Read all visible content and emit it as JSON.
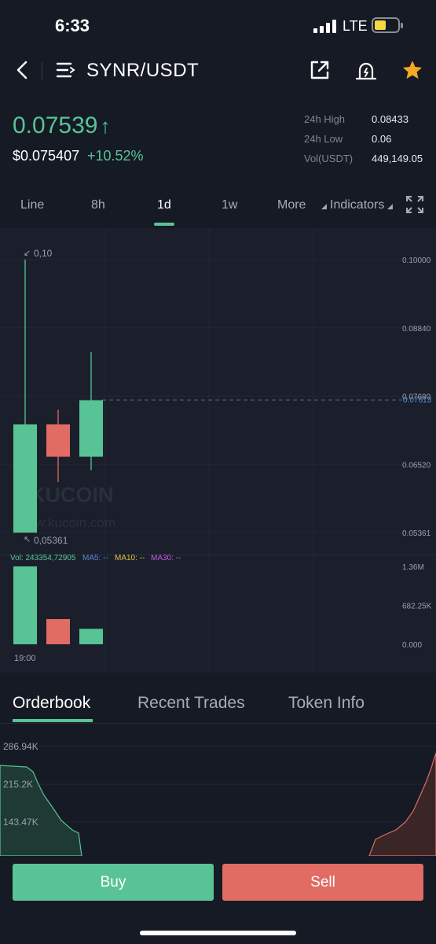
{
  "status": {
    "time": "6:33",
    "network": "LTE"
  },
  "header": {
    "pair": "SYNR/USDT"
  },
  "ticker": {
    "last_price": "0.07539",
    "arrow": "↑",
    "price_usd": "$0.075407",
    "change": "+10.52%",
    "high_label": "24h High",
    "high_value": "0.08433",
    "low_label": "24h Low",
    "low_value": "0.06",
    "vol_label": "Vol(USDT)",
    "vol_value": "449,149.05"
  },
  "timeframes": {
    "line": "Line",
    "h8": "8h",
    "d1": "1d",
    "w1": "1w",
    "more": "More",
    "indicators": "Indicators"
  },
  "colors": {
    "up": "#58c495",
    "down": "#e06c64",
    "bg": "#161a25",
    "chart_bg": "#1b1f2b"
  },
  "chart_data": {
    "type": "candlestick",
    "price_axis_labels": [
      "0.10000",
      "0.08840",
      "0.07680",
      "0.06520",
      "0.05361"
    ],
    "price_ylim": [
      0.05361,
      0.1
    ],
    "max_label": "0,10",
    "min_label": "0,05361",
    "current_price_label": "0.07613",
    "current_price": 0.07613,
    "watermark_brand": "KUCOIN",
    "watermark_url": "w.kucoin.com",
    "candles": [
      {
        "open": 0.072,
        "close": 0.0536,
        "high": 0.1,
        "low": 0.0536,
        "direction": "up"
      },
      {
        "open": 0.072,
        "close": 0.0665,
        "high": 0.0745,
        "low": 0.0622,
        "direction": "down"
      },
      {
        "open": 0.0665,
        "close": 0.0761,
        "high": 0.0843,
        "low": 0.0642,
        "direction": "up"
      }
    ],
    "volume_legend": {
      "vol": "Vol: 243354,72905",
      "ma5": "MA5: --",
      "ma10": "MA10: --",
      "ma30": "MA30: --"
    },
    "volume_axis_labels": [
      "1.36M",
      "682.25K",
      "0.000"
    ],
    "volume_ylim": [
      0,
      1360000
    ],
    "volume_values": [
      1360000,
      440000,
      270000
    ],
    "x_label": "19:00"
  },
  "orderbook": {
    "tabs": [
      "Orderbook",
      "Recent Trades",
      "Token Info"
    ],
    "depth_labels": [
      "286.94K",
      "215.2K",
      "143.47K"
    ]
  },
  "actions": {
    "buy": "Buy",
    "sell": "Sell"
  }
}
